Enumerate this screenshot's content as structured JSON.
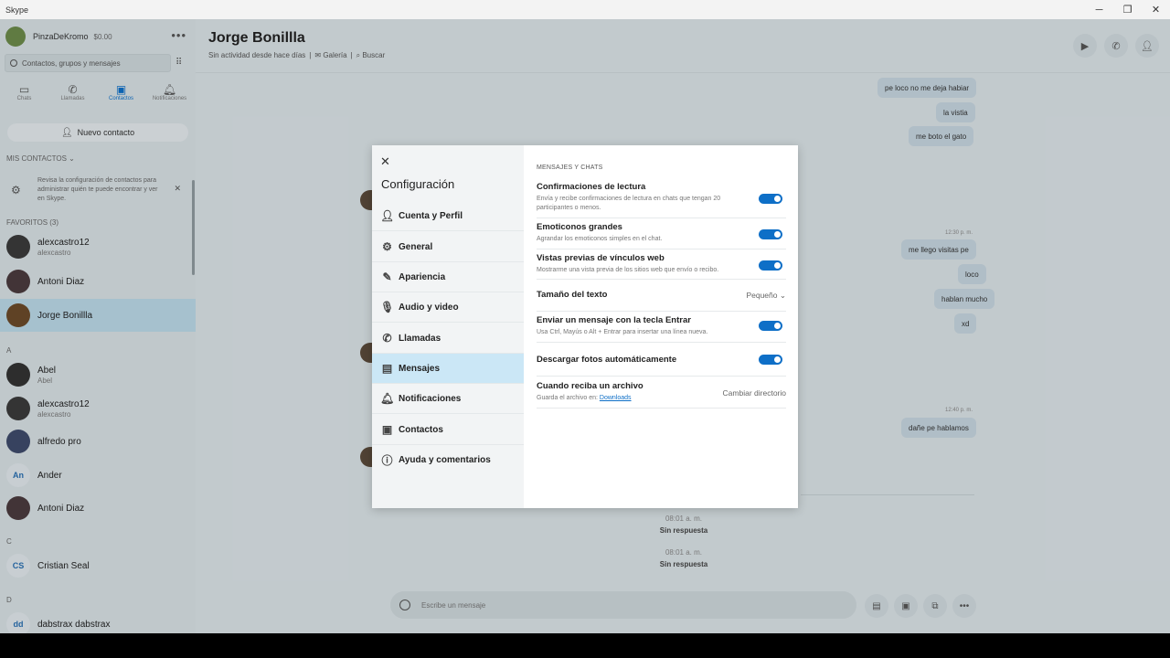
{
  "window": {
    "title": "Skype",
    "controls": [
      "─",
      "❐",
      "✕"
    ]
  },
  "sidebar": {
    "profile_name": "PinzaDeKromo",
    "credit": "$0.00",
    "search_placeholder": "Contactos, grupos y mensajes",
    "nav": [
      {
        "label": "Chats",
        "icon": "chat-icon"
      },
      {
        "label": "Llamadas",
        "icon": "phone-icon"
      },
      {
        "label": "Contactos",
        "icon": "contacts-icon",
        "active": true
      },
      {
        "label": "Notificaciones",
        "icon": "bell-icon"
      }
    ],
    "new_contact": "Nuevo contacto",
    "my_contacts": "MIS CONTACTOS",
    "notice": "Revisa la configuración de contactos para administrar quién te puede encontrar y ver en Skype.",
    "favorites_label": "FAVORITOS (3)",
    "favorites": [
      {
        "name": "alexcastro12",
        "sub": "alexcastro"
      },
      {
        "name": "Antoni Diaz",
        "sub": ""
      },
      {
        "name": "Jorge Bonillla",
        "sub": "",
        "selected": true
      }
    ],
    "letters": [
      "A",
      "C",
      "D"
    ],
    "contacts": [
      {
        "name": "Abel",
        "sub": "Abel"
      },
      {
        "name": "alexcastro12",
        "sub": "alexcastro"
      },
      {
        "name": "alfredo pro",
        "sub": ""
      },
      {
        "name": "Ander",
        "sub": "",
        "initials": "An"
      },
      {
        "name": "Antoni Diaz",
        "sub": ""
      },
      {
        "name": "Cristian Seal",
        "sub": "",
        "initials": "CS"
      },
      {
        "name": "dabstrax dabstrax",
        "sub": "",
        "initials": "dd"
      }
    ]
  },
  "chat": {
    "title": "Jorge Bonillla",
    "status": "Sin actividad desde hace días",
    "gallery": "Galería",
    "search": "Buscar",
    "messages": [
      "pe loco no me deja habiar",
      "la vistia",
      "me boto el gato",
      "me llego visitas pe",
      "loco",
      "hablan mucho",
      "xd",
      "dañe pe hablamos"
    ],
    "timestamps": [
      "12:30 p. m.",
      "12:40 p. m."
    ],
    "calls": [
      {
        "time": "08:01 a. m.",
        "label": "Sin respuesta"
      },
      {
        "time": "08:01 a. m.",
        "label": "Sin respuesta"
      }
    ],
    "composer_placeholder": "Escribe un mensaje"
  },
  "settings": {
    "title": "Configuración",
    "menu": [
      {
        "label": "Cuenta y Perfil",
        "icon": "person-icon"
      },
      {
        "label": "General",
        "icon": "gear-icon"
      },
      {
        "label": "Apariencia",
        "icon": "wand-icon"
      },
      {
        "label": "Audio y video",
        "icon": "mic-icon"
      },
      {
        "label": "Llamadas",
        "icon": "phone-icon"
      },
      {
        "label": "Mensajes",
        "icon": "message-icon",
        "active": true
      },
      {
        "label": "Notificaciones",
        "icon": "bell-icon"
      },
      {
        "label": "Contactos",
        "icon": "contacts-icon"
      },
      {
        "label": "Ayuda y comentarios",
        "icon": "info-icon"
      }
    ],
    "section": "MENSAJES Y CHATS",
    "rows": [
      {
        "title": "Confirmaciones de lectura",
        "desc": "Envía y recibe confirmaciones de lectura en chats que tengan 20 participantes o menos.",
        "toggle": true
      },
      {
        "title": "Emoticonos grandes",
        "desc": "Agrandar los emoticonos simples en el chat.",
        "toggle": true
      },
      {
        "title": "Vistas previas de vínculos web",
        "desc": "Mostrarme una vista previa de los sitios web que envío o recibo.",
        "toggle": true
      },
      {
        "title": "Tamaño del texto",
        "value": "Pequeño"
      },
      {
        "title": "Enviar un mensaje con la tecla Entrar",
        "desc": "Usa Ctrl, Mayús o Alt + Entrar para insertar una línea nueva.",
        "toggle": true
      },
      {
        "title": "Descargar fotos automáticamente",
        "toggle": true
      },
      {
        "title": "Cuando reciba un archivo",
        "desc_prefix": "Guarda el archivo en:",
        "link": "Downloads",
        "value": "Cambiar directorio"
      }
    ],
    "accent": "#0e6fc7"
  }
}
